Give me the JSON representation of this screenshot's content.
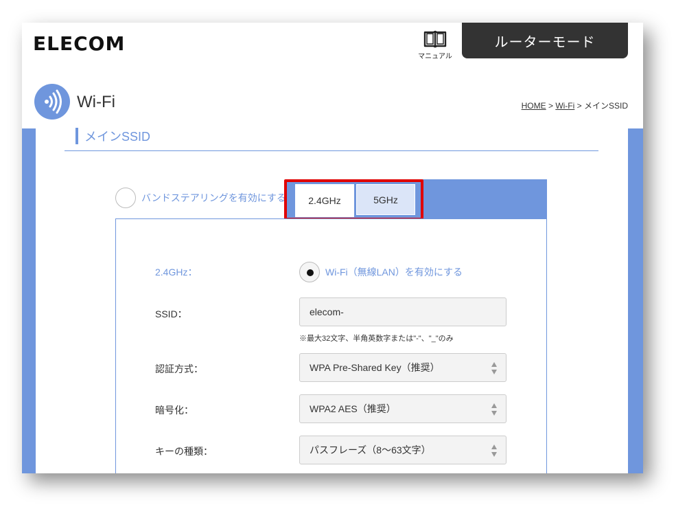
{
  "header": {
    "logo": "ELECOM",
    "manual_label": "マニュアル",
    "mode_label": "ルーターモード"
  },
  "page": {
    "title": "Wi-Fi",
    "breadcrumb": {
      "home": "HOME",
      "sep1": " > ",
      "wifi": "Wi-Fi",
      "sep2": " > ",
      "current": "メインSSID"
    }
  },
  "section": {
    "title": "メインSSID"
  },
  "band_steering": {
    "label": "バンドステアリングを有効にする",
    "checked": false
  },
  "tabs": [
    {
      "label": "2.4GHz",
      "active": true
    },
    {
      "label": "5GHz",
      "active": false
    }
  ],
  "form": {
    "band_label": "2.4GHz：",
    "enable_label": "Wi-Fi（無線LAN）を有効にする",
    "enable_checked": true,
    "ssid_label": "SSID：",
    "ssid_value": "elecom-",
    "ssid_note": "※最大32文字、半角英数字または\"-\"、\"_\"のみ",
    "auth_label": "認証方式：",
    "auth_value": "WPA Pre-Shared Key（推奨）",
    "enc_label": "暗号化：",
    "enc_value": "WPA2 AES（推奨）",
    "keytype_label": "キーの種類：",
    "keytype_value": "パスフレーズ（8〜63文字）"
  },
  "colors": {
    "accent": "#6f96dd",
    "highlight": "#e00000",
    "mode_bg": "#333333"
  },
  "icons": {
    "manual": "book-icon",
    "wifi": "wifi-signal-icon",
    "select": "updown-arrows-icon"
  }
}
